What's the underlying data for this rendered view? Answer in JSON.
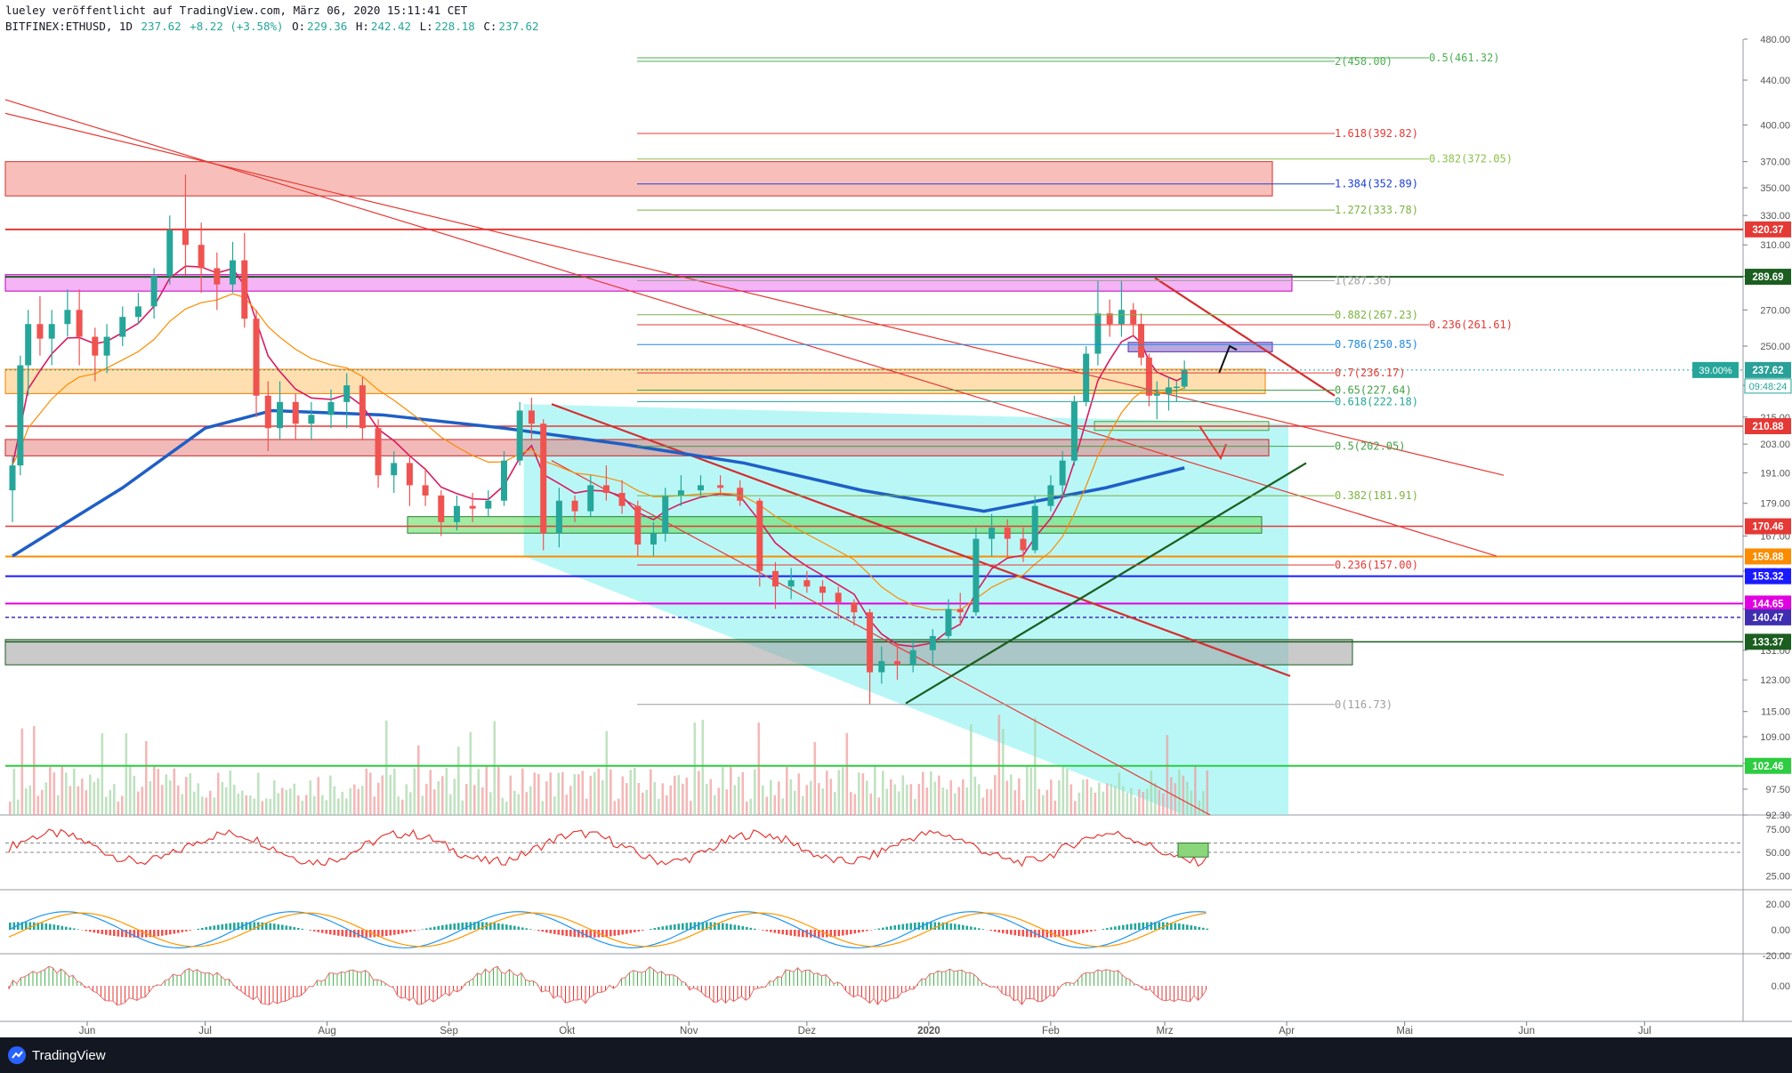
{
  "header": {
    "line1": "lueley veröffentlicht auf TradingView.com, März 06, 2020 15:11:41 CET",
    "symbol": "BITFINEX:ETHUSD, 1D",
    "close_value": "237.62",
    "change": "+8.22 (+3.58%)",
    "o_label": "O:",
    "o_value": "229.36",
    "h_label": "H:",
    "h_value": "242.42",
    "l_label": "L:",
    "l_value": "228.18",
    "c_label": "C:",
    "c_value": "237.62"
  },
  "brand": {
    "name": "TradingView",
    "logo_icon": "tradingview-logo-icon"
  },
  "colors": {
    "up": "#26a69a",
    "down": "#ef5350",
    "sma200": "#1e5fc6",
    "resistance": "#e53935",
    "support_green": "#4caf50",
    "forecast_zone": "#7ff0f0"
  },
  "chart_data": {
    "type": "candlestick",
    "symbol": "BITFINEX:ETHUSD",
    "timeframe": "1D",
    "scale": "log",
    "ylim": [
      92.3,
      480.0
    ],
    "y_ticks": [
      "480.00",
      "440.00",
      "400.00",
      "370.00",
      "350.00",
      "330.00",
      "310.00",
      "290.00",
      "270.00",
      "250.00",
      "230.00",
      "215.00",
      "203.00",
      "191.00",
      "179.00",
      "167.00",
      "155.00",
      "143.00",
      "131.00",
      "123.00",
      "115.00",
      "109.00",
      "103.00",
      "97.50",
      "92.30"
    ],
    "x_ticks": [
      "Jun",
      "Jul",
      "Aug",
      "Sep",
      "Okt",
      "Nov",
      "Dez",
      "2020",
      "Feb",
      "Mrz",
      "Apr",
      "Mai",
      "Jun",
      "Jul"
    ],
    "last_price": 237.62,
    "price_labels": [
      {
        "value": "320.37",
        "color": "#e53935"
      },
      {
        "value": "289.69",
        "color": "#1b5e20"
      },
      {
        "value": "237.62",
        "color": "#2aa198"
      },
      {
        "value": "210.88",
        "color": "#e53935"
      },
      {
        "value": "170.46",
        "color": "#e53935"
      },
      {
        "value": "159.88",
        "color": "#fb8c00"
      },
      {
        "value": "153.32",
        "color": "#1a1aff"
      },
      {
        "value": "144.65",
        "color": "#e100e1"
      },
      {
        "value": "140.47",
        "color": "#3f2fb0"
      },
      {
        "value": "133.37",
        "color": "#1b5e20"
      },
      {
        "value": "102.46",
        "color": "#2ecc40"
      }
    ],
    "countdown_label": "09:48:24",
    "percent_label": "39.00%",
    "fib_retracement": [
      {
        "label": "1(287.36)",
        "price": 287.36,
        "color": "#9e9e9e"
      },
      {
        "label": "0.882(267.23)",
        "price": 267.23,
        "color": "#7cb342"
      },
      {
        "label": "0.786(250.85)",
        "price": 250.85,
        "color": "#1e88e5"
      },
      {
        "label": "0.7(236.17)",
        "price": 236.17,
        "color": "#e53935"
      },
      {
        "label": "0.65(227.64)",
        "price": 227.64,
        "color": "#43a047"
      },
      {
        "label": "0.618(222.18)",
        "price": 222.18,
        "color": "#26a69a"
      },
      {
        "label": "0.5(202.05)",
        "price": 202.05,
        "color": "#43a047"
      },
      {
        "label": "0.382(181.91)",
        "price": 181.91,
        "color": "#7cb342"
      },
      {
        "label": "0.236(157.00)",
        "price": 157.0,
        "color": "#e53935"
      },
      {
        "label": "0(116.73)",
        "price": 116.73,
        "color": "#9e9e9e"
      }
    ],
    "fib_extension": [
      {
        "label": "2(458.00)",
        "price": 458.0,
        "color": "#4caf50"
      },
      {
        "label": "1.618(392.82)",
        "price": 392.82,
        "color": "#e53935"
      },
      {
        "label": "1.384(352.89)",
        "price": 352.89,
        "color": "#1e40d6"
      },
      {
        "label": "1.272(333.78)",
        "price": 333.78,
        "color": "#7cb342"
      }
    ],
    "fib_right": [
      {
        "label": "0.5(461.32)",
        "price": 461.32,
        "color": "#4caf50"
      },
      {
        "label": "0.382(372.05)",
        "price": 372.05,
        "color": "#8bc34a"
      },
      {
        "label": "0.236(261.61)",
        "price": 261.61,
        "color": "#e53935"
      }
    ],
    "candles": [
      {
        "date": "2019-05-13",
        "open": 184,
        "high": 198,
        "low": 172,
        "close": 194
      },
      {
        "date": "2019-05-15",
        "open": 194,
        "high": 245,
        "low": 190,
        "close": 240
      },
      {
        "date": "2019-05-17",
        "open": 240,
        "high": 270,
        "low": 225,
        "close": 262
      },
      {
        "date": "2019-05-20",
        "open": 262,
        "high": 278,
        "low": 245,
        "close": 254
      },
      {
        "date": "2019-05-23",
        "open": 254,
        "high": 270,
        "low": 240,
        "close": 262
      },
      {
        "date": "2019-05-27",
        "open": 262,
        "high": 282,
        "low": 255,
        "close": 270
      },
      {
        "date": "2019-05-30",
        "open": 270,
        "high": 282,
        "low": 240,
        "close": 255
      },
      {
        "date": "2019-06-03",
        "open": 255,
        "high": 260,
        "low": 232,
        "close": 245
      },
      {
        "date": "2019-06-06",
        "open": 245,
        "high": 262,
        "low": 236,
        "close": 255
      },
      {
        "date": "2019-06-10",
        "open": 255,
        "high": 272,
        "low": 250,
        "close": 266
      },
      {
        "date": "2019-06-14",
        "open": 266,
        "high": 280,
        "low": 262,
        "close": 272
      },
      {
        "date": "2019-06-18",
        "open": 272,
        "high": 295,
        "low": 265,
        "close": 290
      },
      {
        "date": "2019-06-22",
        "open": 290,
        "high": 330,
        "low": 285,
        "close": 320
      },
      {
        "date": "2019-06-26",
        "open": 320,
        "high": 360,
        "low": 290,
        "close": 310
      },
      {
        "date": "2019-06-30",
        "open": 310,
        "high": 325,
        "low": 280,
        "close": 295
      },
      {
        "date": "2019-07-04",
        "open": 295,
        "high": 305,
        "low": 270,
        "close": 285
      },
      {
        "date": "2019-07-08",
        "open": 285,
        "high": 312,
        "low": 280,
        "close": 300
      },
      {
        "date": "2019-07-11",
        "open": 300,
        "high": 318,
        "low": 260,
        "close": 265
      },
      {
        "date": "2019-07-14",
        "open": 265,
        "high": 270,
        "low": 215,
        "close": 225
      },
      {
        "date": "2019-07-17",
        "open": 225,
        "high": 232,
        "low": 200,
        "close": 210
      },
      {
        "date": "2019-07-20",
        "open": 210,
        "high": 232,
        "low": 205,
        "close": 222
      },
      {
        "date": "2019-07-24",
        "open": 222,
        "high": 226,
        "low": 205,
        "close": 212
      },
      {
        "date": "2019-07-28",
        "open": 212,
        "high": 222,
        "low": 205,
        "close": 216
      },
      {
        "date": "2019-08-02",
        "open": 216,
        "high": 228,
        "low": 210,
        "close": 222
      },
      {
        "date": "2019-08-06",
        "open": 222,
        "high": 236,
        "low": 210,
        "close": 230
      },
      {
        "date": "2019-08-10",
        "open": 230,
        "high": 234,
        "low": 205,
        "close": 210
      },
      {
        "date": "2019-08-14",
        "open": 210,
        "high": 214,
        "low": 185,
        "close": 190
      },
      {
        "date": "2019-08-18",
        "open": 190,
        "high": 200,
        "low": 183,
        "close": 195
      },
      {
        "date": "2019-08-22",
        "open": 195,
        "high": 198,
        "low": 178,
        "close": 186
      },
      {
        "date": "2019-08-26",
        "open": 186,
        "high": 193,
        "low": 178,
        "close": 182
      },
      {
        "date": "2019-08-30",
        "open": 182,
        "high": 184,
        "low": 167,
        "close": 172
      },
      {
        "date": "2019-09-03",
        "open": 172,
        "high": 182,
        "low": 169,
        "close": 178
      },
      {
        "date": "2019-09-07",
        "open": 178,
        "high": 183,
        "low": 172,
        "close": 177
      },
      {
        "date": "2019-09-11",
        "open": 177,
        "high": 184,
        "low": 174,
        "close": 180
      },
      {
        "date": "2019-09-15",
        "open": 180,
        "high": 200,
        "low": 178,
        "close": 196
      },
      {
        "date": "2019-09-19",
        "open": 196,
        "high": 222,
        "low": 194,
        "close": 218
      },
      {
        "date": "2019-09-22",
        "open": 218,
        "high": 224,
        "low": 205,
        "close": 212
      },
      {
        "date": "2019-09-25",
        "open": 212,
        "high": 214,
        "low": 162,
        "close": 168
      },
      {
        "date": "2019-09-29",
        "open": 168,
        "high": 185,
        "low": 163,
        "close": 180
      },
      {
        "date": "2019-10-03",
        "open": 180,
        "high": 182,
        "low": 172,
        "close": 176
      },
      {
        "date": "2019-10-07",
        "open": 176,
        "high": 190,
        "low": 174,
        "close": 186
      },
      {
        "date": "2019-10-11",
        "open": 186,
        "high": 194,
        "low": 180,
        "close": 183
      },
      {
        "date": "2019-10-15",
        "open": 183,
        "high": 188,
        "low": 175,
        "close": 178
      },
      {
        "date": "2019-10-19",
        "open": 178,
        "high": 180,
        "low": 160,
        "close": 164
      },
      {
        "date": "2019-10-23",
        "open": 164,
        "high": 172,
        "low": 160,
        "close": 168
      },
      {
        "date": "2019-10-26",
        "open": 168,
        "high": 185,
        "low": 165,
        "close": 182
      },
      {
        "date": "2019-10-30",
        "open": 182,
        "high": 190,
        "low": 178,
        "close": 184
      },
      {
        "date": "2019-11-04",
        "open": 184,
        "high": 190,
        "low": 181,
        "close": 186
      },
      {
        "date": "2019-11-09",
        "open": 186,
        "high": 190,
        "low": 182,
        "close": 185
      },
      {
        "date": "2019-11-14",
        "open": 185,
        "high": 188,
        "low": 178,
        "close": 180
      },
      {
        "date": "2019-11-19",
        "open": 180,
        "high": 181,
        "low": 150,
        "close": 155
      },
      {
        "date": "2019-11-23",
        "open": 155,
        "high": 158,
        "low": 143,
        "close": 150
      },
      {
        "date": "2019-11-27",
        "open": 150,
        "high": 156,
        "low": 146,
        "close": 152
      },
      {
        "date": "2019-12-01",
        "open": 152,
        "high": 155,
        "low": 148,
        "close": 150
      },
      {
        "date": "2019-12-05",
        "open": 150,
        "high": 152,
        "low": 145,
        "close": 148
      },
      {
        "date": "2019-12-09",
        "open": 148,
        "high": 150,
        "low": 140,
        "close": 145
      },
      {
        "date": "2019-12-13",
        "open": 145,
        "high": 146,
        "low": 138,
        "close": 142
      },
      {
        "date": "2019-12-17",
        "open": 142,
        "high": 143,
        "low": 116.73,
        "close": 125
      },
      {
        "date": "2019-12-20",
        "open": 125,
        "high": 132,
        "low": 122,
        "close": 128
      },
      {
        "date": "2019-12-24",
        "open": 128,
        "high": 133,
        "low": 123,
        "close": 127
      },
      {
        "date": "2019-12-28",
        "open": 127,
        "high": 134,
        "low": 125,
        "close": 131
      },
      {
        "date": "2020-01-02",
        "open": 131,
        "high": 137,
        "low": 127,
        "close": 135
      },
      {
        "date": "2020-01-06",
        "open": 135,
        "high": 146,
        "low": 133,
        "close": 143
      },
      {
        "date": "2020-01-09",
        "open": 143,
        "high": 148,
        "low": 138,
        "close": 142
      },
      {
        "date": "2020-01-13",
        "open": 142,
        "high": 170,
        "low": 141,
        "close": 166
      },
      {
        "date": "2020-01-17",
        "open": 166,
        "high": 175,
        "low": 160,
        "close": 170
      },
      {
        "date": "2020-01-21",
        "open": 170,
        "high": 173,
        "low": 160,
        "close": 166
      },
      {
        "date": "2020-01-25",
        "open": 166,
        "high": 170,
        "low": 158,
        "close": 162
      },
      {
        "date": "2020-01-28",
        "open": 162,
        "high": 182,
        "low": 161,
        "close": 178
      },
      {
        "date": "2020-02-01",
        "open": 178,
        "high": 190,
        "low": 176,
        "close": 186
      },
      {
        "date": "2020-02-04",
        "open": 186,
        "high": 200,
        "low": 182,
        "close": 196
      },
      {
        "date": "2020-02-07",
        "open": 196,
        "high": 225,
        "low": 194,
        "close": 222
      },
      {
        "date": "2020-02-10",
        "open": 222,
        "high": 250,
        "low": 220,
        "close": 246
      },
      {
        "date": "2020-02-13",
        "open": 246,
        "high": 287.36,
        "low": 240,
        "close": 268
      },
      {
        "date": "2020-02-16",
        "open": 268,
        "high": 276,
        "low": 255,
        "close": 262
      },
      {
        "date": "2020-02-19",
        "open": 262,
        "high": 287,
        "low": 255,
        "close": 270
      },
      {
        "date": "2020-02-22",
        "open": 270,
        "high": 274,
        "low": 255,
        "close": 262
      },
      {
        "date": "2020-02-24",
        "open": 262,
        "high": 268,
        "low": 240,
        "close": 244
      },
      {
        "date": "2020-02-26",
        "open": 244,
        "high": 246,
        "low": 220,
        "close": 225
      },
      {
        "date": "2020-02-28",
        "open": 225,
        "high": 232,
        "low": 214,
        "close": 226
      },
      {
        "date": "2020-03-02",
        "open": 226,
        "high": 234,
        "low": 218,
        "close": 229
      },
      {
        "date": "2020-03-04",
        "open": 229,
        "high": 232,
        "low": 222,
        "close": 229.36
      },
      {
        "date": "2020-03-06",
        "open": 229.36,
        "high": 242.42,
        "low": 228.18,
        "close": 237.62
      }
    ],
    "sma200": [
      {
        "date": "2019-05-13",
        "value": 160
      },
      {
        "date": "2019-06-10",
        "value": 185
      },
      {
        "date": "2019-07-01",
        "value": 210
      },
      {
        "date": "2019-07-18",
        "value": 218
      },
      {
        "date": "2019-08-15",
        "value": 216
      },
      {
        "date": "2019-09-15",
        "value": 210
      },
      {
        "date": "2019-10-15",
        "value": 203
      },
      {
        "date": "2019-11-15",
        "value": 195
      },
      {
        "date": "2019-12-15",
        "value": 184
      },
      {
        "date": "2020-01-15",
        "value": 176
      },
      {
        "date": "2020-02-15",
        "value": 185
      },
      {
        "date": "2020-03-06",
        "value": 193
      }
    ],
    "rsi_panel": {
      "ticks": [
        "75.00",
        "50.00",
        "25.00"
      ]
    },
    "macd_panel": {
      "ticks": [
        "20.00",
        "0.00",
        "-20.00"
      ]
    },
    "osc_panel": {
      "ticks": [
        "0.00"
      ]
    }
  }
}
